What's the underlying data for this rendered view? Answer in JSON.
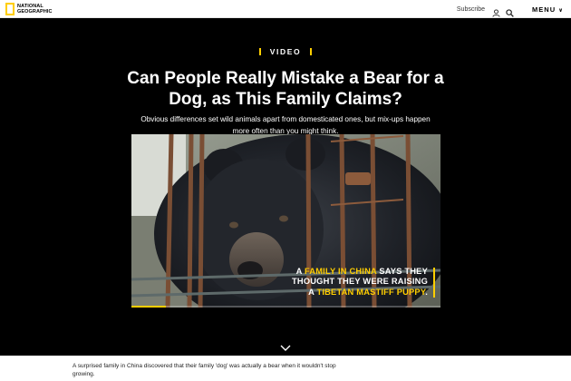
{
  "header": {
    "logo_line1": "NATIONAL",
    "logo_line2": "GEOGRAPHIC",
    "subscribe": "Subscribe",
    "user_icon": "user-icon",
    "search_icon": "search-icon",
    "menu": "MENU"
  },
  "article": {
    "kicker": "VIDEO",
    "headline": "Can People Really Mistake a Bear for a Dog, as This Family Claims?",
    "dek": "Obvious differences set wild animals apart from domesticated ones, but mix-ups happen more often than you might think.",
    "body": "A surprised family in China discovered that their family 'dog' was actually a bear when it wouldn't stop growing."
  },
  "video": {
    "caption": {
      "l1_pre": "A ",
      "l1_hl": "FAMILY IN CHINA",
      "l1_post": " SAYS THEY",
      "l2": "THOUGHT THEY WERE RAISING",
      "l3_pre": "A ",
      "l3_hl": "TIBETAN MASTIFF PUPPY",
      "l3_post": "."
    },
    "progress_fraction": 0.11
  },
  "colors": {
    "accent": "#ffce00",
    "hero_bg": "#000000",
    "text_light": "#ffffff"
  }
}
